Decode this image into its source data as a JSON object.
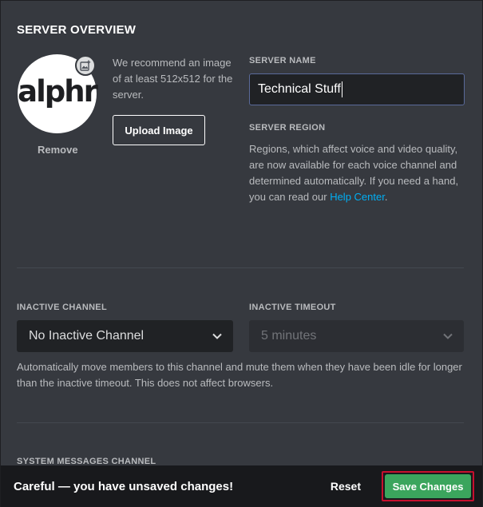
{
  "page_title": "SERVER OVERVIEW",
  "avatar": {
    "logo_text": "alphr",
    "remove_label": "Remove"
  },
  "upload": {
    "recommendation": "We recommend an image of at least 512x512 for the server.",
    "button_label": "Upload Image"
  },
  "server_name": {
    "label": "SERVER NAME",
    "value": "Technical Stuff"
  },
  "server_region": {
    "label": "SERVER REGION",
    "text_before_link": "Regions, which affect voice and video quality, are now available for each voice channel and determined automatically. If you need a hand, you can read our ",
    "link_text": "Help Center",
    "text_after_link": "."
  },
  "inactive_channel": {
    "label": "INACTIVE CHANNEL",
    "value": "No Inactive Channel"
  },
  "inactive_timeout": {
    "label": "INACTIVE TIMEOUT",
    "value": "5 minutes",
    "disabled": true
  },
  "inactive_help": "Automatically move members to this channel and mute them when they have been idle for longer than the inactive timeout. This does not affect browsers.",
  "system_messages": {
    "label": "SYSTEM MESSAGES CHANNEL"
  },
  "unsaved_bar": {
    "message": "Careful — you have unsaved changes!",
    "reset_label": "Reset",
    "save_label": "Save Changes"
  },
  "colors": {
    "background": "#36393f",
    "input_bg": "#202225",
    "link": "#00aff4",
    "save_green": "#3ba55d",
    "highlight_red": "#c8102e"
  }
}
